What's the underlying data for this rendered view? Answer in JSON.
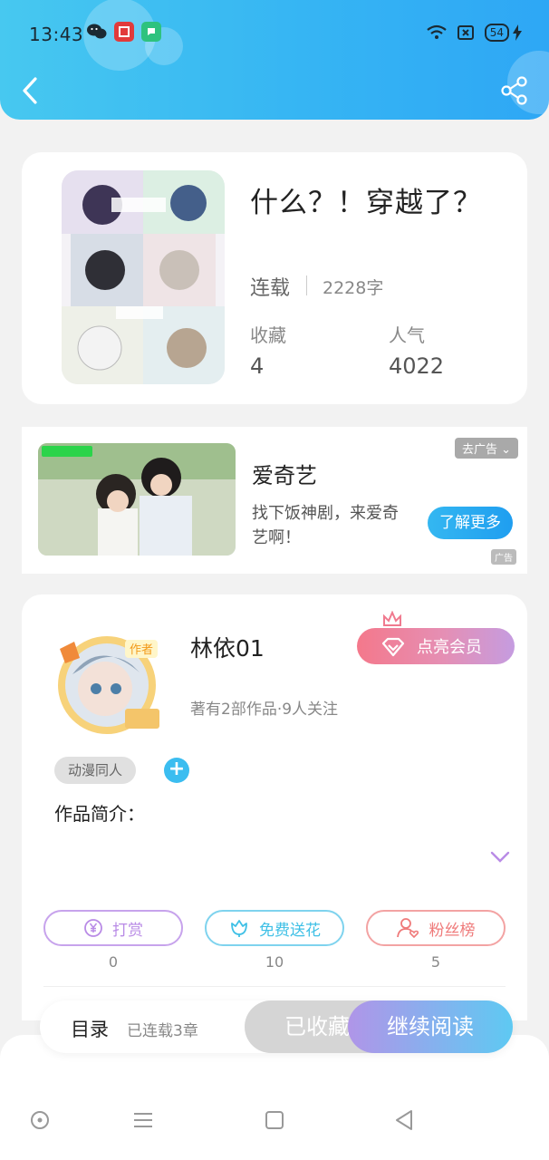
{
  "status_bar": {
    "time": "13:43",
    "battery": "54"
  },
  "book": {
    "title": "什么？！穿越了？",
    "status": "连载",
    "word_count": "2228字",
    "favorites_label": "收藏",
    "favorites_value": "4",
    "popularity_label": "人气",
    "popularity_value": "4022"
  },
  "ad": {
    "close_label": "去广告",
    "title": "爱奇艺",
    "description": "找下饭神剧，来爱奇艺啊！",
    "cta": "了解更多",
    "tag": "广告"
  },
  "author": {
    "name": "林依01",
    "meta": "著有2部作品·9人关注",
    "vip_label": "点亮会员",
    "tag": "动漫同人",
    "add_tag": "+",
    "intro_label": "作品简介："
  },
  "actions": [
    {
      "label": "打赏",
      "count": "0",
      "color": "#b98be6"
    },
    {
      "label": "免费送花",
      "count": "10",
      "color": "#3fc0e6"
    },
    {
      "label": "粉丝榜",
      "count": "5",
      "color": "#ef7a7a"
    }
  ],
  "read_bar": {
    "toc_label": "目录",
    "toc_meta": "已连载3章",
    "favorited_label": "已收藏",
    "continue_label": "继续阅读"
  },
  "colors": {
    "header_accent": "#36b5f3",
    "vip_gradient_start": "#f4788b",
    "continue_gradient_end": "#5ec9f2"
  }
}
